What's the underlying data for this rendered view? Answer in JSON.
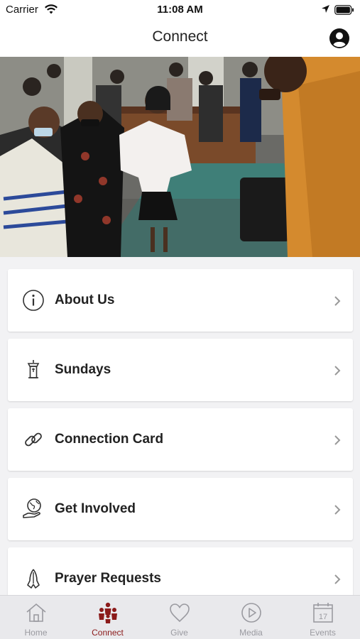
{
  "status_bar": {
    "carrier": "Carrier",
    "time": "11:08 AM"
  },
  "nav": {
    "title": "Connect"
  },
  "menu": [
    {
      "label": "About Us",
      "icon": "info-icon"
    },
    {
      "label": "Sundays",
      "icon": "pulpit-icon"
    },
    {
      "label": "Connection Card",
      "icon": "link-icon"
    },
    {
      "label": "Get Involved",
      "icon": "globe-hand-icon"
    },
    {
      "label": "Prayer Requests",
      "icon": "praying-hands-icon"
    }
  ],
  "tabs": [
    {
      "label": "Home",
      "icon": "home-icon",
      "active": false
    },
    {
      "label": "Connect",
      "icon": "people-icon",
      "active": true
    },
    {
      "label": "Give",
      "icon": "heart-icon",
      "active": false
    },
    {
      "label": "Media",
      "icon": "play-icon",
      "active": false
    },
    {
      "label": "Events",
      "icon": "calendar-icon",
      "active": false
    }
  ],
  "colors": {
    "accent": "#8b1a1a",
    "inactive": "#9a9aa0",
    "background": "#f2f2f4"
  },
  "calendar_day": "17"
}
